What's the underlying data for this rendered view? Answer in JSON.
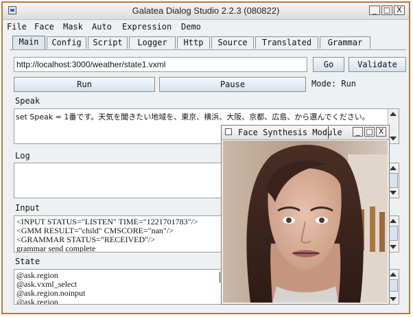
{
  "window": {
    "title": "Galatea Dialog Studio 2.2.3 (080822)",
    "controls": [
      "_",
      "□",
      "X"
    ]
  },
  "menu": [
    "File",
    "Face",
    "Mask",
    "Auto",
    "Expression",
    "Demo"
  ],
  "tabs": [
    "Main",
    "Config",
    "Script",
    "Logger",
    "Http",
    "Source",
    "Translated",
    "Grammar"
  ],
  "active_tab": "Main",
  "url_value": "http://localhost:3000/weather/state1.vxml",
  "buttons": {
    "go": "Go",
    "validate": "Validate",
    "run": "Run",
    "pause": "Pause"
  },
  "mode_text": "Mode: Run",
  "sections": {
    "speak": {
      "label": "Speak",
      "text": "set Speak = 1番です。天気を聞きたい地域を、東京、横浜、大阪、京都、広島、から選んでください。"
    },
    "log": {
      "label": "Log"
    },
    "input": {
      "label": "Input",
      "lines": [
        "<INPUT STATUS=\"LISTEN\" TIME=\"1221701783\"/>",
        "<GMM RESULT=\"child\" CMSCORE=\"nan\"/>",
        "<GRAMMAR STATUS=\"RECEIVED\"/>",
        "grammar send complete"
      ]
    },
    "state": {
      "label": "State",
      "lines": [
        "@ask.region",
        "@ask.vxml_select",
        "@ask.region.noinput",
        "@ask.region"
      ]
    }
  },
  "face_window": {
    "title": "Face Synthesis Module",
    "controls": [
      "_",
      "□",
      "X"
    ]
  },
  "colors": {
    "frame_border": "#b07a3a",
    "button_top": "#f4f8fc",
    "button_bottom": "#d6e1ec",
    "panel_bg": "#eef1f3"
  }
}
